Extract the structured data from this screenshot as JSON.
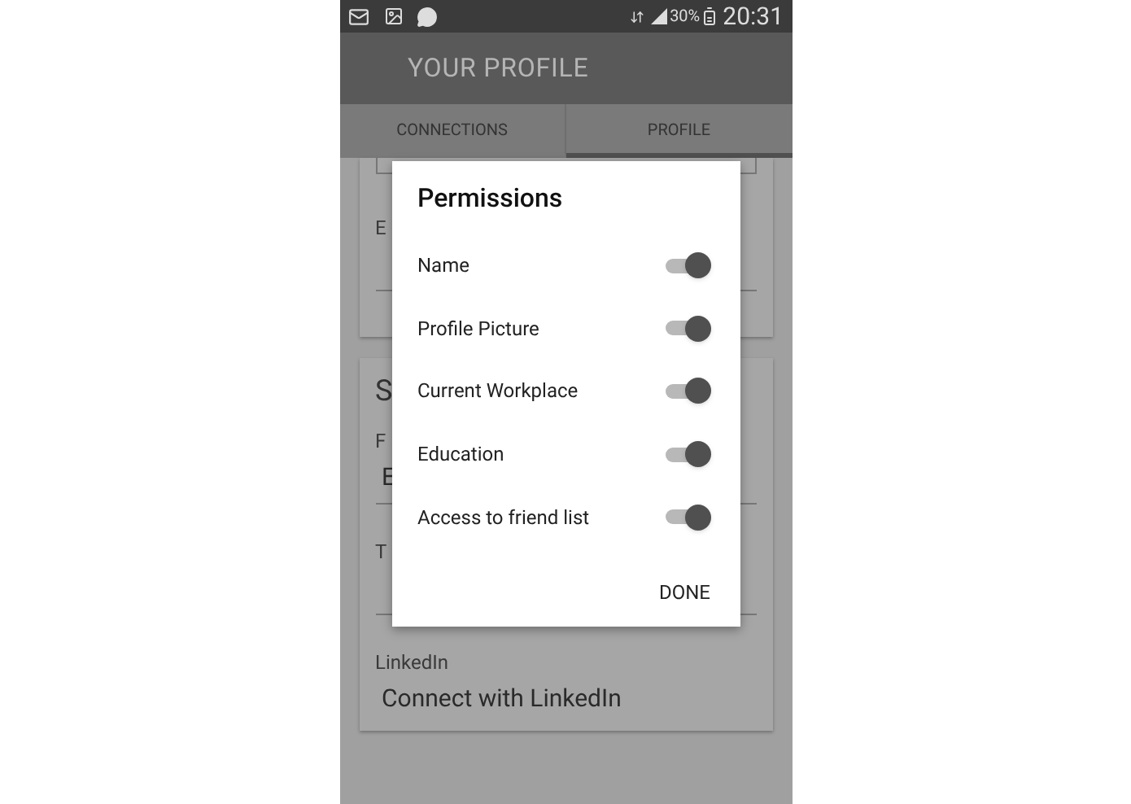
{
  "status_bar": {
    "battery": "30%",
    "time": "20:31"
  },
  "app_bar": {
    "title": "YOUR PROFILE"
  },
  "tabs": [
    {
      "label": "CONNECTIONS",
      "selected": false
    },
    {
      "label": "PROFILE",
      "selected": true
    }
  ],
  "card_1": {
    "fields": [
      {
        "label": "E"
      }
    ]
  },
  "card_2": {
    "heading": "S",
    "fields": [
      {
        "label": "F",
        "value": "E"
      },
      {
        "label": "T"
      },
      {
        "label": "LinkedIn",
        "value": "Connect with LinkedIn"
      }
    ]
  },
  "dialog": {
    "title": "Permissions",
    "permissions": [
      {
        "label": "Name",
        "on": true
      },
      {
        "label": "Profile Picture",
        "on": true
      },
      {
        "label": "Current Workplace",
        "on": true
      },
      {
        "label": "Education",
        "on": true
      },
      {
        "label": "Access to friend list",
        "on": true
      }
    ],
    "button": "DONE"
  }
}
